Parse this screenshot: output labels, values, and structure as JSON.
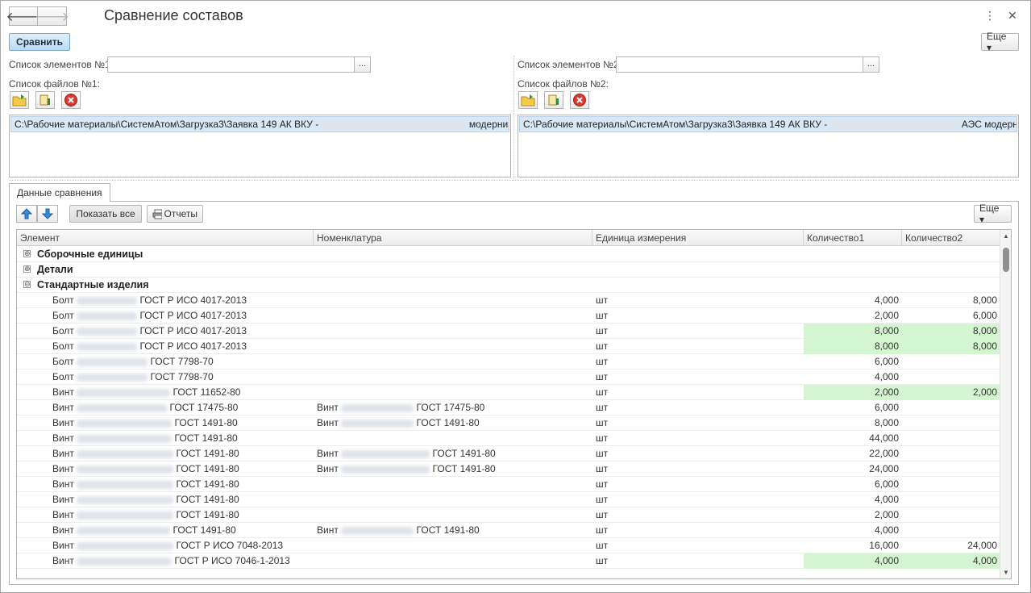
{
  "window": {
    "title": "Сравнение составов",
    "more_icon": "kebab-icon",
    "close_icon": "close-icon"
  },
  "toolbar": {
    "compare_label": "Сравнить",
    "more_label": "Еще ▾"
  },
  "left": {
    "elements_label": "Список элементов №1:",
    "elements_value": "",
    "files_label": "Список файлов №1:",
    "file_prefix": "C:\\Рабочие материалы\\СистемАтом\\Загрузка3\\Заявка 149 АК ВКУ -",
    "file_suffix": "модерниза..."
  },
  "right": {
    "elements_label": "Список элементов №2:",
    "elements_value": "",
    "files_label": "Список файлов №2:",
    "file_prefix": "C:\\Рабочие материалы\\СистемАтом\\Загрузка3\\Заявка 149 АК ВКУ -",
    "file_suffix": "АЭС модерниза..."
  },
  "tabs": {
    "data_tab": "Данные сравнения"
  },
  "comparison": {
    "show_all_label": "Показать все",
    "reports_label": "Отчеты",
    "more_label": "Еще ▾",
    "columns": [
      "Элемент",
      "Номенклатура",
      "Единица измерения",
      "Количество1",
      "Количество2"
    ],
    "groups": [
      {
        "label": "Сборочные единицы",
        "state": "⊕"
      },
      {
        "label": "Детали",
        "state": "⊕"
      },
      {
        "label": "Стандартные изделия",
        "state": "⊖"
      }
    ],
    "rows": [
      {
        "el_a": "Болт",
        "el_b": "ГОСТ Р ИСО 4017-2013",
        "nom_a": "",
        "nom_b": "",
        "unit": "шт",
        "q1": "4,000",
        "q2": "8,000",
        "hl": false
      },
      {
        "el_a": "Болт",
        "el_b": "ГОСТ Р ИСО 4017-2013",
        "nom_a": "",
        "nom_b": "",
        "unit": "шт",
        "q1": "2,000",
        "q2": "6,000",
        "hl": false
      },
      {
        "el_a": "Болт",
        "el_b": "ГОСТ Р ИСО 4017-2013",
        "nom_a": "",
        "nom_b": "",
        "unit": "шт",
        "q1": "8,000",
        "q2": "8,000",
        "hl": true
      },
      {
        "el_a": "Болт",
        "el_b": "ГОСТ Р ИСО 4017-2013",
        "nom_a": "",
        "nom_b": "",
        "unit": "шт",
        "q1": "8,000",
        "q2": "8,000",
        "hl": true
      },
      {
        "el_a": "Болт",
        "el_b": "ГОСТ 7798-70",
        "nom_a": "",
        "nom_b": "",
        "unit": "шт",
        "q1": "6,000",
        "q2": "",
        "hl": false
      },
      {
        "el_a": "Болт",
        "el_b": "ГОСТ 7798-70",
        "nom_a": "",
        "nom_b": "",
        "unit": "шт",
        "q1": "4,000",
        "q2": "",
        "hl": false
      },
      {
        "el_a": "Винт",
        "el_b": "ГОСТ 11652-80",
        "nom_a": "",
        "nom_b": "",
        "unit": "шт",
        "q1": "2,000",
        "q2": "2,000",
        "hl": true
      },
      {
        "el_a": "Винт",
        "el_b": "ГОСТ 17475-80",
        "nom_a": "Винт",
        "nom_b": "ГОСТ 17475-80",
        "unit": "шт",
        "q1": "6,000",
        "q2": "",
        "hl": false
      },
      {
        "el_a": "Винт",
        "el_b": "ГОСТ 1491-80",
        "nom_a": "Винт",
        "nom_b": "ГОСТ 1491-80",
        "unit": "шт",
        "q1": "8,000",
        "q2": "",
        "hl": false
      },
      {
        "el_a": "Винт",
        "el_b": "ГОСТ 1491-80",
        "nom_a": "",
        "nom_b": "",
        "unit": "шт",
        "q1": "44,000",
        "q2": "",
        "hl": false
      },
      {
        "el_a": "Винт",
        "el_b": "ГОСТ 1491-80",
        "nom_a": "Винт",
        "nom_b": "ГОСТ 1491-80",
        "unit": "шт",
        "q1": "22,000",
        "q2": "",
        "hl": false
      },
      {
        "el_a": "Винт",
        "el_b": "ГОСТ 1491-80",
        "nom_a": "Винт",
        "nom_b": "ГОСТ 1491-80",
        "unit": "шт",
        "q1": "24,000",
        "q2": "",
        "hl": false
      },
      {
        "el_a": "Винт",
        "el_b": "ГОСТ 1491-80",
        "nom_a": "",
        "nom_b": "",
        "unit": "шт",
        "q1": "6,000",
        "q2": "",
        "hl": false
      },
      {
        "el_a": "Винт",
        "el_b": "ГОСТ 1491-80",
        "nom_a": "",
        "nom_b": "",
        "unit": "шт",
        "q1": "4,000",
        "q2": "",
        "hl": false
      },
      {
        "el_a": "Винт",
        "el_b": "ГОСТ 1491-80",
        "nom_a": "",
        "nom_b": "",
        "unit": "шт",
        "q1": "2,000",
        "q2": "",
        "hl": false
      },
      {
        "el_a": "Винт",
        "el_b": "ГОСТ 1491-80",
        "nom_a": "Винт",
        "nom_b": "ГОСТ 1491-80",
        "unit": "шт",
        "q1": "4,000",
        "q2": "",
        "hl": false
      },
      {
        "el_a": "Винт",
        "el_b": "ГОСТ Р ИСО 7048-2013",
        "nom_a": "",
        "nom_b": "",
        "unit": "шт",
        "q1": "16,000",
        "q2": "24,000",
        "hl": false
      },
      {
        "el_a": "Винт",
        "el_b": "ГОСТ Р ИСО 7046-1-2013",
        "nom_a": "",
        "nom_b": "",
        "unit": "шт",
        "q1": "4,000",
        "q2": "4,000",
        "hl": true
      }
    ]
  },
  "colors": {
    "highlight": "#d3f5cf",
    "primary_button": "#b9dcf3",
    "selection": "#d9e8f6"
  }
}
